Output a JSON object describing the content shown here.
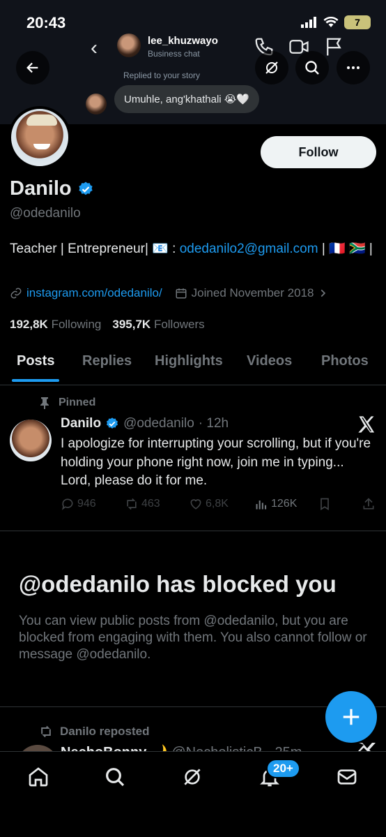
{
  "status_bar": {
    "time": "20:43",
    "battery": "7"
  },
  "dm_preview": {
    "username": "lee_khuzwayo",
    "subtitle": "Business chat",
    "replied_label": "Replied to your story",
    "message": "Umuhle, ang'khathali 😭🤍"
  },
  "profile": {
    "display_name": "Danilo",
    "handle": "@odedanilo",
    "follow_label": "Follow",
    "bio_prefix": "Teacher | Entrepreneur| 📧 : ",
    "bio_email": "odedanilo2@gmail.com",
    "bio_suffix": " | 🇫🇷 🇿🇦 |",
    "website": "instagram.com/odedanilo/",
    "joined": "Joined November 2018",
    "following_count": "192,8K",
    "following_label": "Following",
    "followers_count": "395,7K",
    "followers_label": "Followers"
  },
  "tabs": [
    {
      "label": "Posts"
    },
    {
      "label": "Replies"
    },
    {
      "label": "Highlights"
    },
    {
      "label": "Videos"
    },
    {
      "label": "Photos"
    }
  ],
  "pinned_post": {
    "pinned_label": "Pinned",
    "author": "Danilo",
    "handle": "@odedanilo",
    "time": "· 12h",
    "text": "I apologize for interrupting your scrolling, but if you're holding your phone right now, join me in typing... Lord, please do it for me.",
    "replies": "946",
    "reposts": "463",
    "likes": "6,8K",
    "views": "126K"
  },
  "blocked": {
    "title": "@odedanilo has blocked you",
    "text": "You can view public posts from @odedanilo, but you are blocked from engaging with them. You also cannot follow or message @odedanilo."
  },
  "next_post": {
    "reposted_label": "Danilo reposted",
    "author": "NechoBonny 🌙",
    "handle": "@NecholisticB · 25m"
  },
  "notifications_badge": "20+",
  "colors": {
    "accent": "#1d9bf0",
    "background": "#000000",
    "muted": "#71767b"
  }
}
